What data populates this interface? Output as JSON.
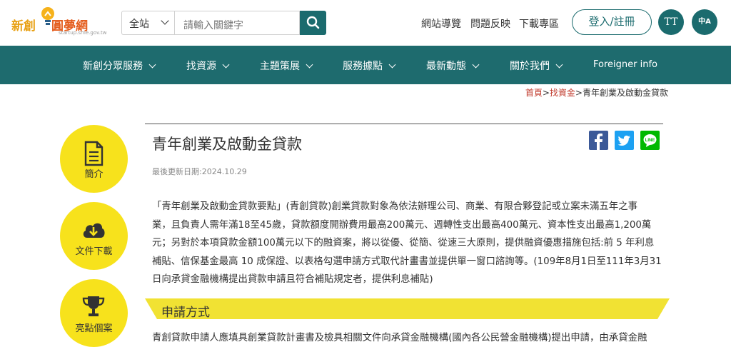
{
  "header": {
    "logo": {
      "main_a": "新創",
      "main_b": "圓夢網",
      "sub": "startup.sme.gov.tw"
    },
    "search": {
      "scope": "全站",
      "placeholder": "請輸入關鍵字"
    },
    "links": [
      "網站導覽",
      "問題反映",
      "下載專區"
    ],
    "login_label": "登入/註冊",
    "font_btn_label": "TT",
    "lang_btn_label": "中A"
  },
  "nav": {
    "items": [
      "新創分眾服務",
      "找資源",
      "主題策展",
      "服務據點",
      "最新動態",
      "關於我們",
      "Foreigner info"
    ]
  },
  "breadcrumb": {
    "home": "首頁",
    "sep1": ">",
    "parent": "找資金",
    "sep2": ">",
    "current": "青年創業及啟動金貸款"
  },
  "sidebar": {
    "items": [
      {
        "label": "簡介",
        "icon": "document-icon"
      },
      {
        "label": "文件下載",
        "icon": "cloud-download-icon"
      },
      {
        "label": "亮點個案",
        "icon": "trophy-icon"
      }
    ]
  },
  "article": {
    "title": "青年創業及啟動金貸款",
    "updated": "最後更新日期:2024.10.29",
    "paragraph_lines": [
      "「青年創業及啟動金貸款要點」(青創貸款)創業貸款對象為依法辦理公司、商業、有限合夥登記或立案未滿五年之事",
      "業，且負責人需年滿18至45歲，貸款額度開辦費用最高200萬元、週轉性支出最高400萬元、資本性支出最高1,200萬",
      "元；另對於本項貸款金額100萬元以下的融資案，將以從優、從簡、從速三大原則，提供融資優惠措施包括:前 5 年利息",
      "補貼、信保基金最高 10 成保證、以表格勾選申請方式取代計畫書並提供單一窗口諮詢等。(109年8月1日至111年3月31",
      "日向承貸金融機構提出貸款申請且符合補貼規定者，提供利息補貼)"
    ],
    "section_title": "申請方式",
    "section_text": "青創貸款申請人應填具創業貸款計畫書及檢具相關文件向承貸金融機構(國內各公民營金融機構)提出申請，由承貸金融"
  },
  "colors": {
    "primary": "#1e6b6e",
    "accent_yellow": "#f7e21c",
    "link_red": "#c0392b"
  }
}
